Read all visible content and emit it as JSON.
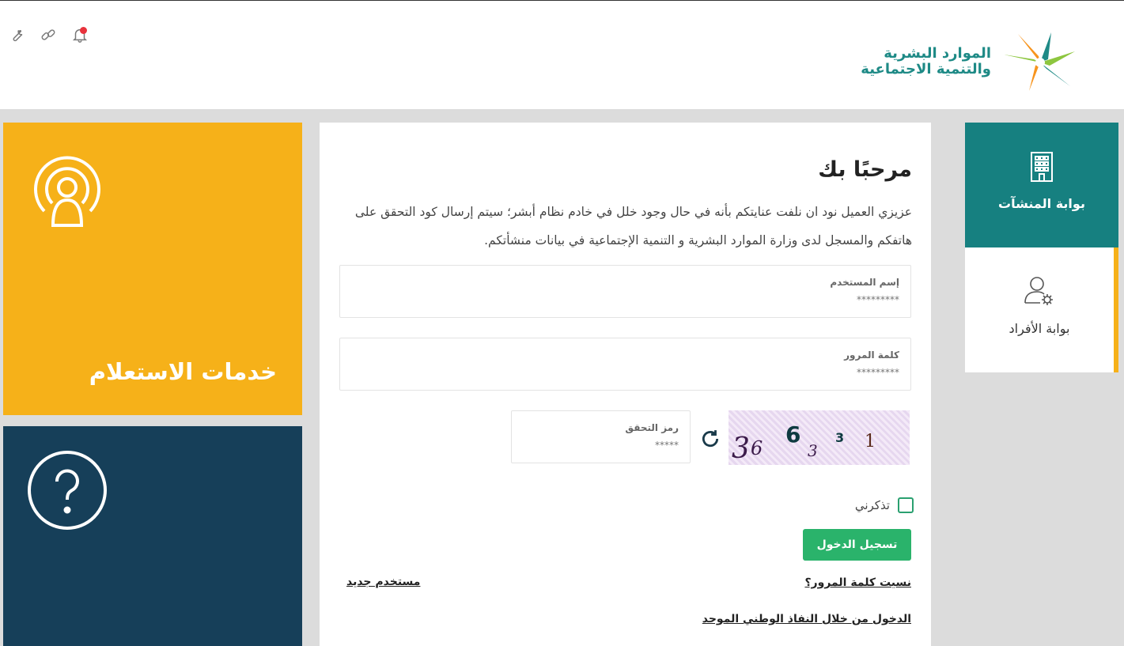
{
  "header": {
    "ministry_line1": "الموارد البشرية",
    "ministry_line2": "والتنمية الاجتماعية",
    "icons": [
      "wrench-icon",
      "link-icon",
      "bell-icon"
    ],
    "notification_color": "#e8323c"
  },
  "tiles": {
    "inquiry_title": "خدمات الاستعلام",
    "inquiry_icon": "user-broadcast-icon",
    "help_icon": "question-circle-icon",
    "yellow": "#f6b119",
    "navy": "#163f59"
  },
  "login": {
    "welcome": "مرحبًا بك",
    "intro": "عزيزي العميل نود ان نلفت عنايتكم بأنه في حال وجود خلل في خادم نظام أبشر؛ سيتم إرسال كود التحقق على هاتفكم والمسجل لدى وزارة الموارد البشرية و التنمية الإجتماعية في بيانات منشأتكم.",
    "username_label": "إسم المستخدم",
    "username_placeholder": "*********",
    "password_label": "كلمة المرور",
    "password_placeholder": "*********",
    "captcha_label": "رمز التحقق",
    "captcha_placeholder": "*****",
    "captcha_text": "36 6 3 3 1",
    "remember_label": "تذكرني",
    "login_button": "تسجيل الدخول",
    "forgot_password": "نسيت كلمة المرور؟",
    "new_user": "مستخدم جديد",
    "nafath_login": "الدخول من خلال النفاذ الوطني الموحد",
    "button_color": "#2ab36b"
  },
  "portals": {
    "business": "بوابة المنشآت",
    "individuals": "بوابة الأفراد",
    "business_color": "#168080"
  }
}
